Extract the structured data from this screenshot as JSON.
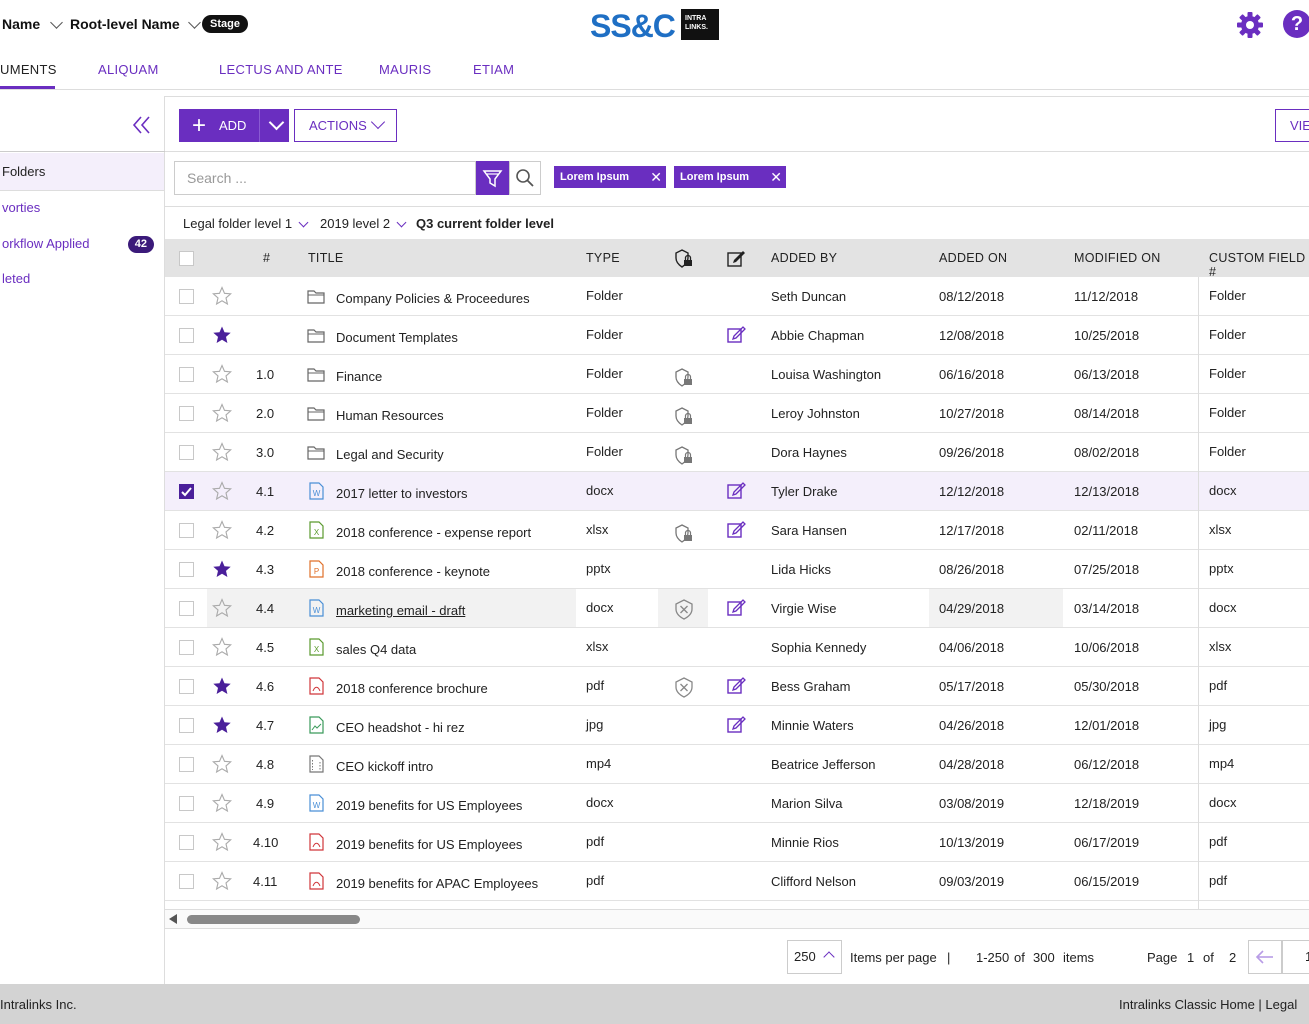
{
  "header": {
    "crumb1": "Name",
    "crumb2": "Root-level Name",
    "stage": "Stage",
    "logo_ssc": "SS&C",
    "logo_il_line1": "INTRA",
    "logo_il_line2": "LINKS.",
    "help": "?"
  },
  "tabs": [
    {
      "label": "UMENTS"
    },
    {
      "label": "ALIQUAM"
    },
    {
      "label": "LECTUS AND ANTE"
    },
    {
      "label": "MAURIS"
    },
    {
      "label": "ETIAM"
    }
  ],
  "sidebar": {
    "items": [
      {
        "label": "Folders"
      },
      {
        "label": "vorties"
      },
      {
        "label": "orkflow Applied",
        "count": "42"
      },
      {
        "label": "leted"
      }
    ]
  },
  "toolbar": {
    "add_label": "ADD",
    "actions_label": "ACTIONS",
    "view_label": "VIE"
  },
  "search": {
    "placeholder": "Search ...",
    "chips": [
      "Lorem Ipsum",
      "Lorem Ipsum"
    ]
  },
  "breadcrumb": {
    "level1": "Legal folder level 1",
    "level2": "2019 level 2",
    "current": "Q3 current folder level"
  },
  "table": {
    "headers": {
      "num": "#",
      "title": "TITLE",
      "type": "TYPE",
      "added_by": "ADDED BY",
      "added_on": "ADDED ON",
      "modified_on": "MODIFIED ON",
      "custom": "CUSTOM FIELD #"
    },
    "rows": [
      {
        "num": "",
        "title": "Company Policies & Proceedures",
        "type": "Folder",
        "added_by": "Seth Duncan",
        "added_on": "08/12/2018",
        "modified_on": "11/12/2018",
        "custom": "Folder",
        "starred": false,
        "checked": false,
        "icon": "folder",
        "lock": "",
        "edit": false
      },
      {
        "num": "",
        "title": "Document Templates",
        "type": "Folder",
        "added_by": "Abbie Chapman",
        "added_on": "12/08/2018",
        "modified_on": "10/25/2018",
        "custom": "Folder",
        "starred": true,
        "checked": false,
        "icon": "folder",
        "lock": "",
        "edit": true
      },
      {
        "num": "1.0",
        "title": "Finance",
        "type": "Folder",
        "added_by": "Louisa Washington",
        "added_on": "06/16/2018",
        "modified_on": "06/13/2018",
        "custom": "Folder",
        "starred": false,
        "checked": false,
        "icon": "folder",
        "lock": "lock",
        "edit": false
      },
      {
        "num": "2.0",
        "title": "Human Resources",
        "type": "Folder",
        "added_by": "Leroy Johnston",
        "added_on": "10/27/2018",
        "modified_on": "08/14/2018",
        "custom": "Folder",
        "starred": false,
        "checked": false,
        "icon": "folder",
        "lock": "lock",
        "edit": false
      },
      {
        "num": "3.0",
        "title": "Legal and Security",
        "type": "Folder",
        "added_by": "Dora Haynes",
        "added_on": "09/26/2018",
        "modified_on": "08/02/2018",
        "custom": "Folder",
        "starred": false,
        "checked": false,
        "icon": "folder",
        "lock": "lock",
        "edit": false
      },
      {
        "num": "4.1",
        "title": "2017 letter to investors",
        "type": "docx",
        "added_by": "Tyler Drake",
        "added_on": "12/12/2018",
        "modified_on": "12/13/2018",
        "custom": "docx",
        "starred": false,
        "checked": true,
        "icon": "word",
        "lock": "",
        "edit": true
      },
      {
        "num": "4.2",
        "title": "2018 conference - expense report",
        "type": "xlsx",
        "added_by": "Sara Hansen",
        "added_on": "12/17/2018",
        "modified_on": "02/11/2018",
        "custom": "xlsx",
        "starred": false,
        "checked": false,
        "icon": "excel",
        "lock": "lock",
        "edit": true
      },
      {
        "num": "4.3",
        "title": "2018 conference - keynote",
        "type": "pptx",
        "added_by": "Lida Hicks",
        "added_on": "08/26/2018",
        "modified_on": "07/25/2018",
        "custom": "pptx",
        "starred": true,
        "checked": false,
        "icon": "ppt",
        "lock": "",
        "edit": false
      },
      {
        "num": "4.4",
        "title": "marketing email - draft",
        "type": "docx",
        "added_by": "Virgie Wise",
        "added_on": "04/29/2018",
        "modified_on": "03/14/2018",
        "custom": "docx",
        "starred": false,
        "checked": false,
        "icon": "word",
        "lock": "x",
        "edit": true,
        "link": true
      },
      {
        "num": "4.5",
        "title": "sales Q4 data",
        "type": "xlsx",
        "added_by": "Sophia Kennedy",
        "added_on": "04/06/2018",
        "modified_on": "10/06/2018",
        "custom": "xlsx",
        "starred": false,
        "checked": false,
        "icon": "excel",
        "lock": "",
        "edit": false
      },
      {
        "num": "4.6",
        "title": "2018 conference brochure",
        "type": "pdf",
        "added_by": "Bess Graham",
        "added_on": "05/17/2018",
        "modified_on": "05/30/2018",
        "custom": "pdf",
        "starred": true,
        "checked": false,
        "icon": "pdf",
        "lock": "x",
        "edit": true
      },
      {
        "num": "4.7",
        "title": "CEO headshot - hi rez",
        "type": "jpg",
        "added_by": "Minnie Waters",
        "added_on": "04/26/2018",
        "modified_on": "12/01/2018",
        "custom": "jpg",
        "starred": true,
        "checked": false,
        "icon": "image",
        "lock": "",
        "edit": true
      },
      {
        "num": "4.8",
        "title": "CEO kickoff intro",
        "type": "mp4",
        "added_by": "Beatrice Jefferson",
        "added_on": "04/28/2018",
        "modified_on": "06/12/2018",
        "custom": "mp4",
        "starred": false,
        "checked": false,
        "icon": "video",
        "lock": "",
        "edit": false
      },
      {
        "num": "4.9",
        "title": "2019 benefits for US Employees",
        "type": "docx",
        "added_by": "Marion Silva",
        "added_on": "03/08/2019",
        "modified_on": "12/18/2019",
        "custom": "docx",
        "starred": false,
        "checked": false,
        "icon": "word",
        "lock": "",
        "edit": false
      },
      {
        "num": "4.10",
        "title": "2019 benefits for US Employees",
        "type": "pdf",
        "added_by": "Minnie Rios",
        "added_on": "10/13/2019",
        "modified_on": "06/17/2019",
        "custom": "pdf",
        "starred": false,
        "checked": false,
        "icon": "pdf",
        "lock": "",
        "edit": false
      },
      {
        "num": "4.11",
        "title": "2019 benefits for APAC Employees",
        "type": "pdf",
        "added_by": "Clifford Nelson",
        "added_on": "09/03/2019",
        "modified_on": "06/15/2019",
        "custom": "pdf",
        "starred": false,
        "checked": false,
        "icon": "pdf",
        "lock": "",
        "edit": false
      }
    ]
  },
  "pager": {
    "per_page": "250",
    "items_per_page": "Items per page",
    "sep": "|",
    "range": "1-250",
    "of": "of",
    "total": "300",
    "items": "items",
    "page_label": "Page",
    "page_current": "1",
    "page_of": "of",
    "page_total": "2",
    "page_input": "1"
  },
  "footer": {
    "left": "Intralinks Inc.",
    "right": "Intralinks Classic Home  |  Legal"
  },
  "colors": {
    "accent": "#6a2ec0",
    "dark_accent": "#3b1a7a",
    "word": "#4a8fd6",
    "excel": "#5a9a2e",
    "ppt": "#e0702a",
    "pdf": "#d0363a",
    "image": "#3a9a5a"
  }
}
